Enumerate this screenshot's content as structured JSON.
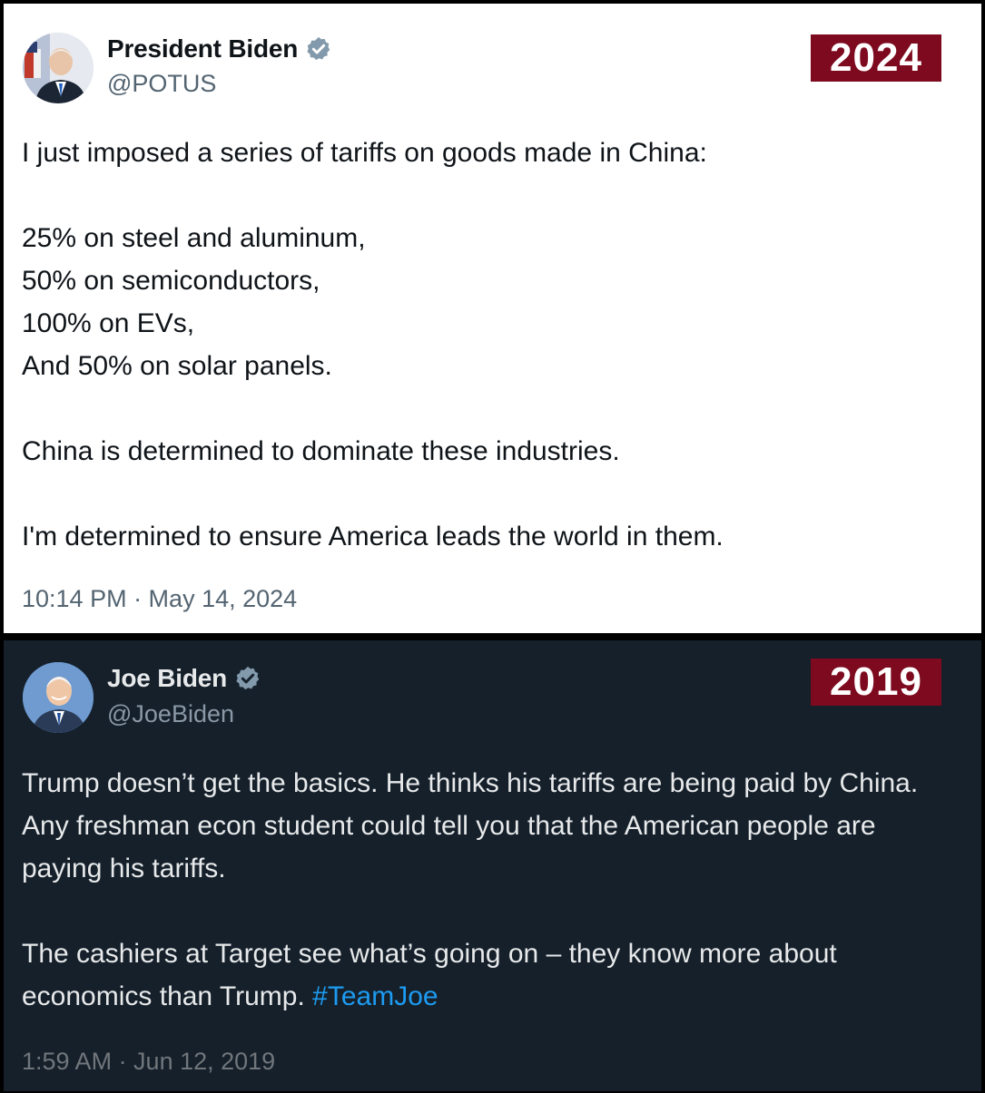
{
  "accent_color": "#7d0a1f",
  "tweets": [
    {
      "theme": "light",
      "display_name": "President Biden",
      "handle": "@POTUS",
      "verified": true,
      "year_badge": "2024",
      "body": "I just imposed a series of tariffs on goods made in China:\n\n25% on steel and aluminum,\n50% on semiconductors,\n100% on EVs,\nAnd 50% on solar panels.\n\nChina is determined to dominate these industries.\n\nI'm determined to ensure America leads the world in them.",
      "timestamp": "10:14 PM · May 14, 2024"
    },
    {
      "theme": "dark",
      "display_name": "Joe Biden",
      "handle": "@JoeBiden",
      "verified": true,
      "year_badge": "2019",
      "body": "Trump doesn’t get the basics. He thinks his tariffs are being paid by China. Any freshman econ student could tell you that the American people are paying his tariffs.\n\nThe cashiers at Target see what’s going on – they know more about economics than Trump. ",
      "hashtag": "#TeamJoe",
      "timestamp": "1:59 AM · Jun 12, 2019"
    }
  ]
}
